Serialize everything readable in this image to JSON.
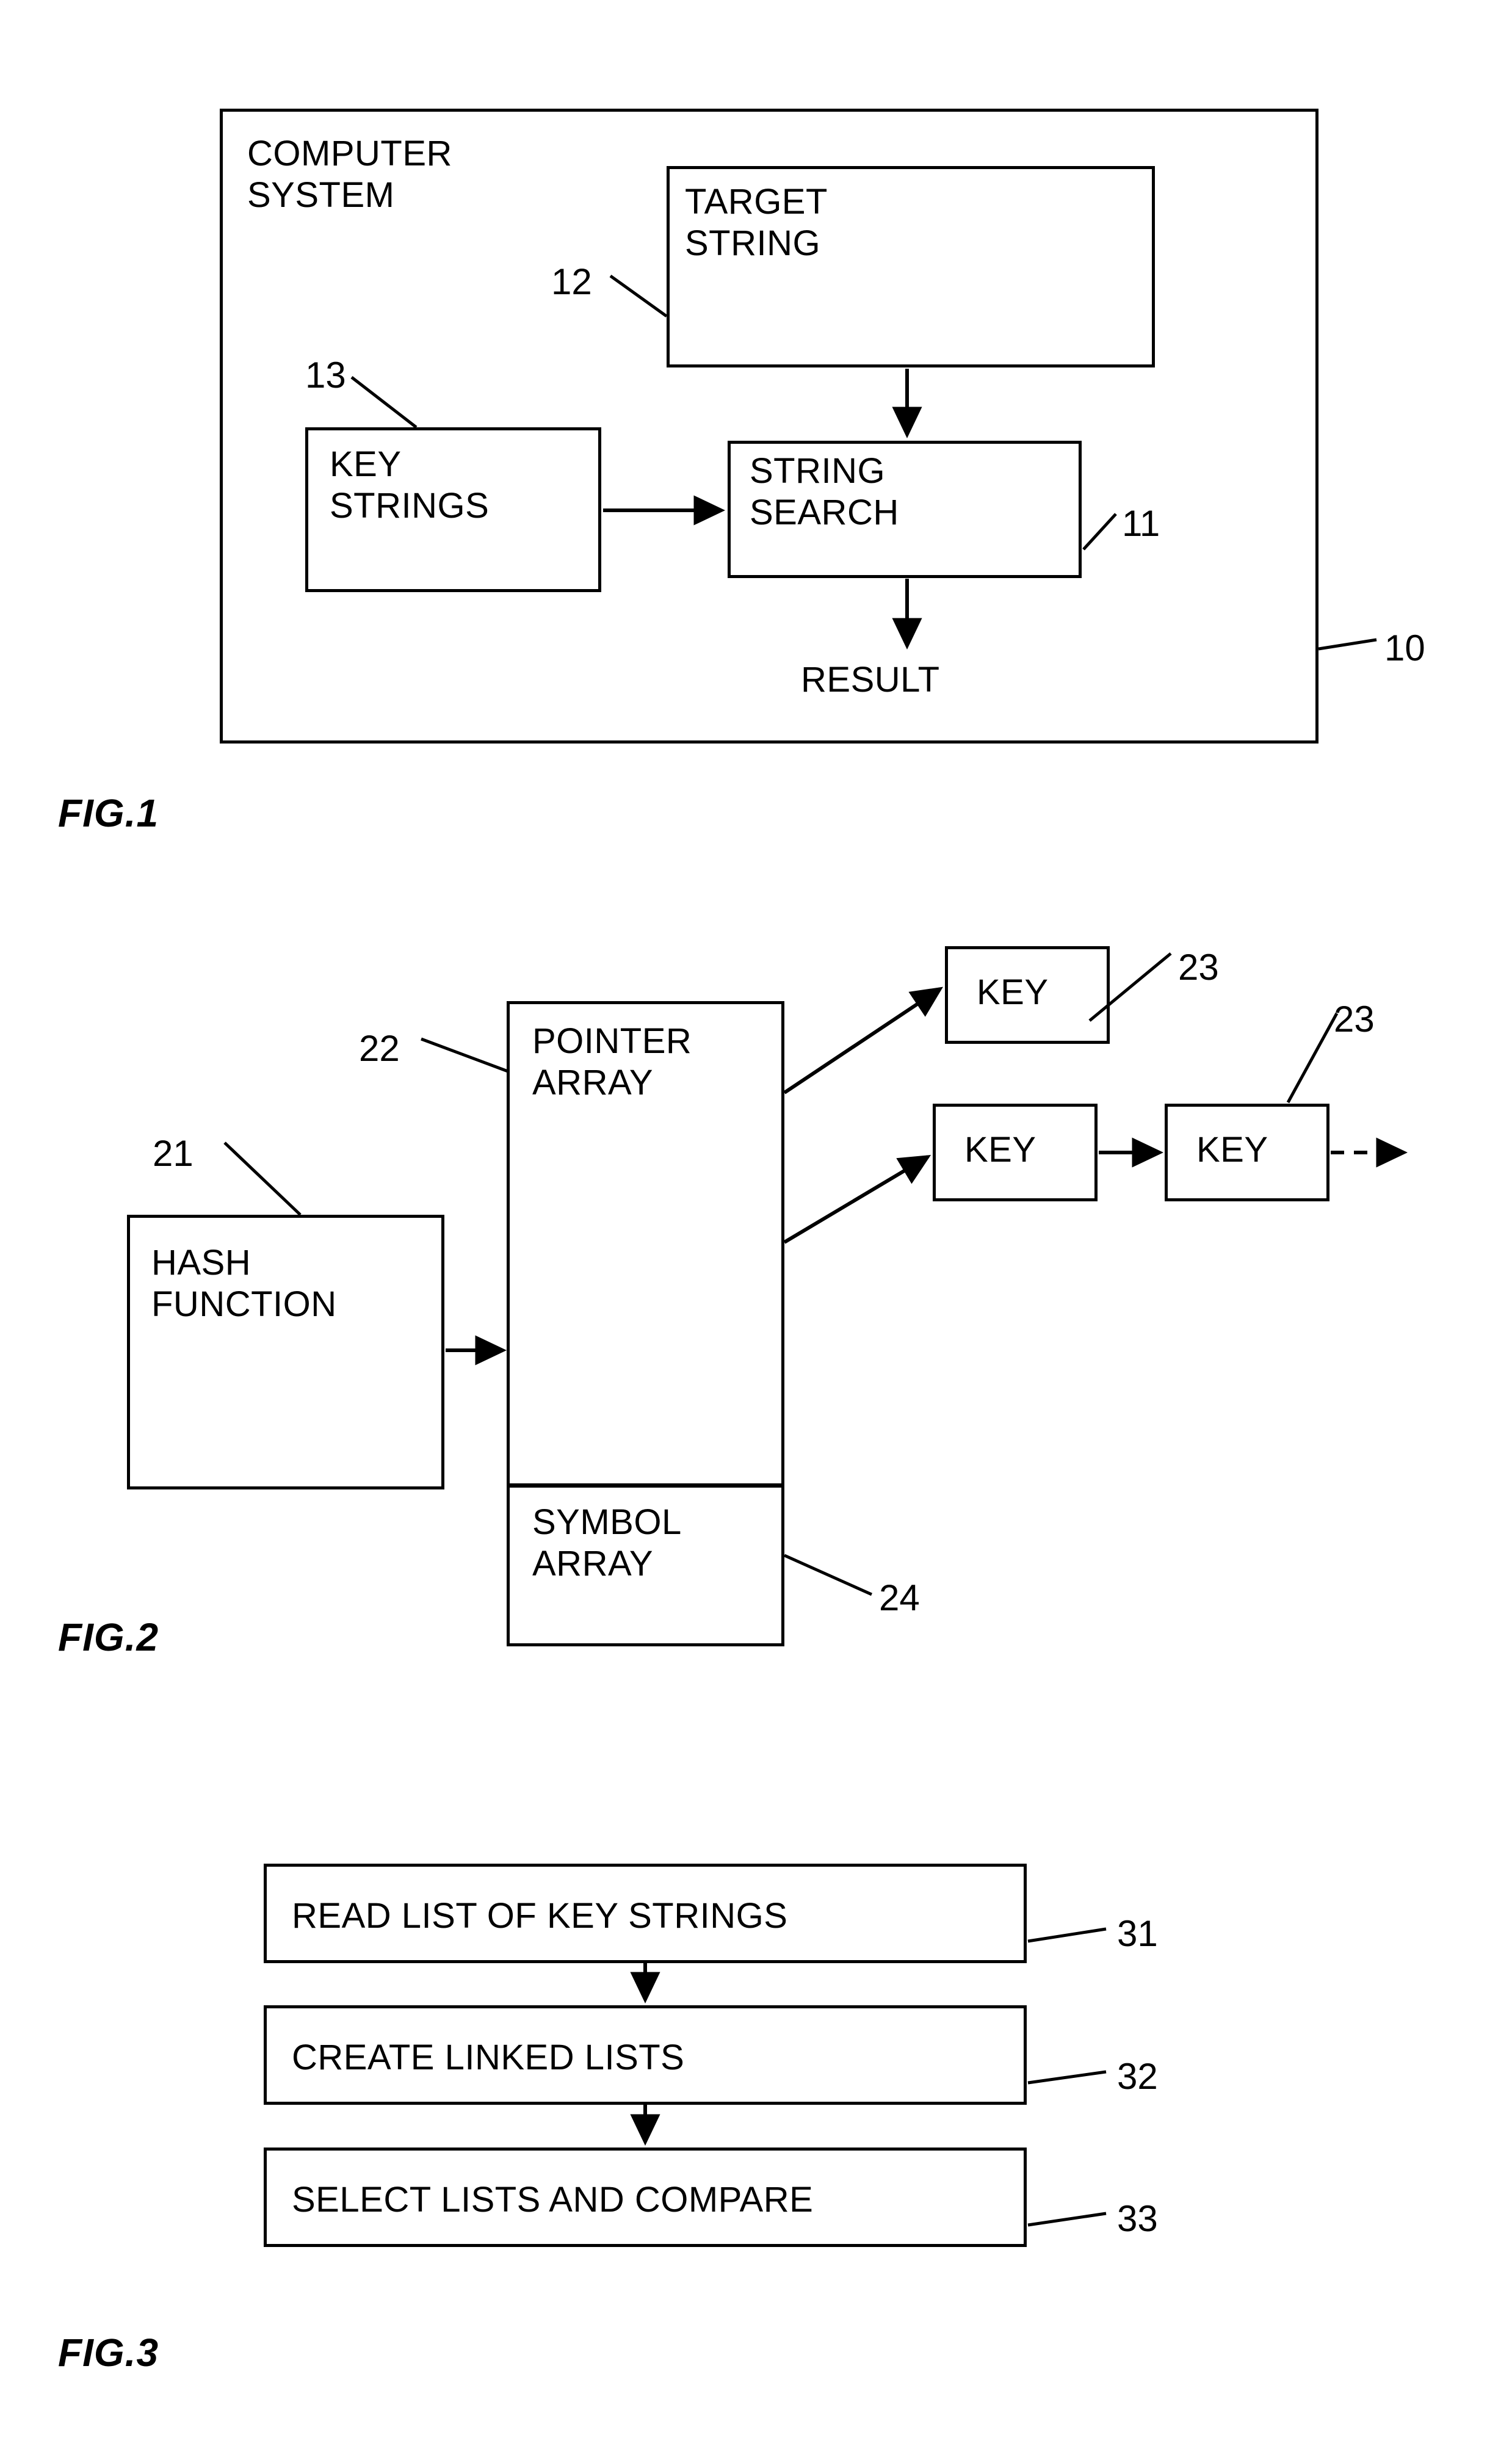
{
  "figures": [
    {
      "id": "fig1",
      "caption": "FIG.1",
      "outer_label": "COMPUTER\nSYSTEM",
      "boxes": {
        "target_string": "TARGET\nSTRING",
        "key_strings": "KEY\nSTRINGS",
        "string_search": "STRING\nSEARCH"
      },
      "free_text": {
        "result": "RESULT"
      },
      "ref_numbers": {
        "system": "10",
        "string_search": "11",
        "target_string": "12",
        "key_strings": "13"
      }
    },
    {
      "id": "fig2",
      "caption": "FIG.2",
      "boxes": {
        "hash_function": "HASH\nFUNCTION",
        "pointer_array": "POINTER\nARRAY",
        "symbol_array": "SYMBOL\nARRAY",
        "key_top": "KEY",
        "key_mid_1": "KEY",
        "key_mid_2": "KEY"
      },
      "ref_numbers": {
        "hash_function": "21",
        "pointer_array": "22",
        "key_top": "23",
        "key_chain": "23",
        "symbol_array": "24"
      }
    },
    {
      "id": "fig3",
      "caption": "FIG.3",
      "steps": [
        {
          "label": "READ LIST OF KEY STRINGS",
          "ref": "31"
        },
        {
          "label": "CREATE LINKED LISTS",
          "ref": "32"
        },
        {
          "label": "SELECT LISTS AND COMPARE",
          "ref": "33"
        }
      ]
    }
  ],
  "style": {
    "ink": "#000000",
    "paper": "#ffffff"
  }
}
